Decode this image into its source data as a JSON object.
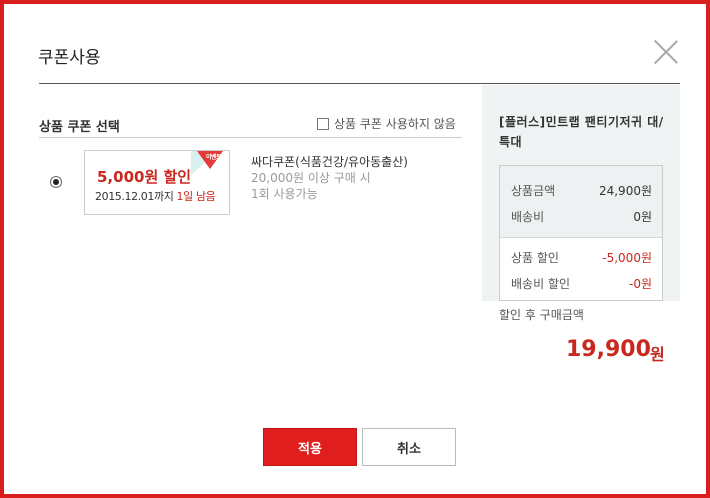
{
  "dialog": {
    "title": "쿠폰사용"
  },
  "coupon_section": {
    "title": "상품 쿠폰 선택",
    "no_use_label": "상품 쿠폰 사용하지 않음",
    "coupon": {
      "amount": "5,000원 할인",
      "expiry": "2015.12.01까지",
      "days_left": "1일 남음",
      "tag": "이벤트",
      "name": "싸다쿠폰(식품건강/유아동출산)",
      "condition": "20,000원 이상 구매 시",
      "usage": "1회 사용가능",
      "selected": true
    }
  },
  "summary": {
    "product_name": "[플러스]민트랩 팬티기저귀 대/특대",
    "rows": [
      {
        "label": "상품금액",
        "value": "24,900원"
      },
      {
        "label": "배송비",
        "value": "0원"
      },
      {
        "label": "상품 할인",
        "value": "-5,000원"
      },
      {
        "label": "배송비 할인",
        "value": "-0원"
      }
    ],
    "after_label": "할인 후 구매금액",
    "total": "19,900",
    "total_unit": "원"
  },
  "buttons": {
    "apply": "적용",
    "cancel": "취소"
  },
  "colors": {
    "accent": "#e11e1e",
    "discount": "#c8281e",
    "border": "#d81e1e"
  }
}
